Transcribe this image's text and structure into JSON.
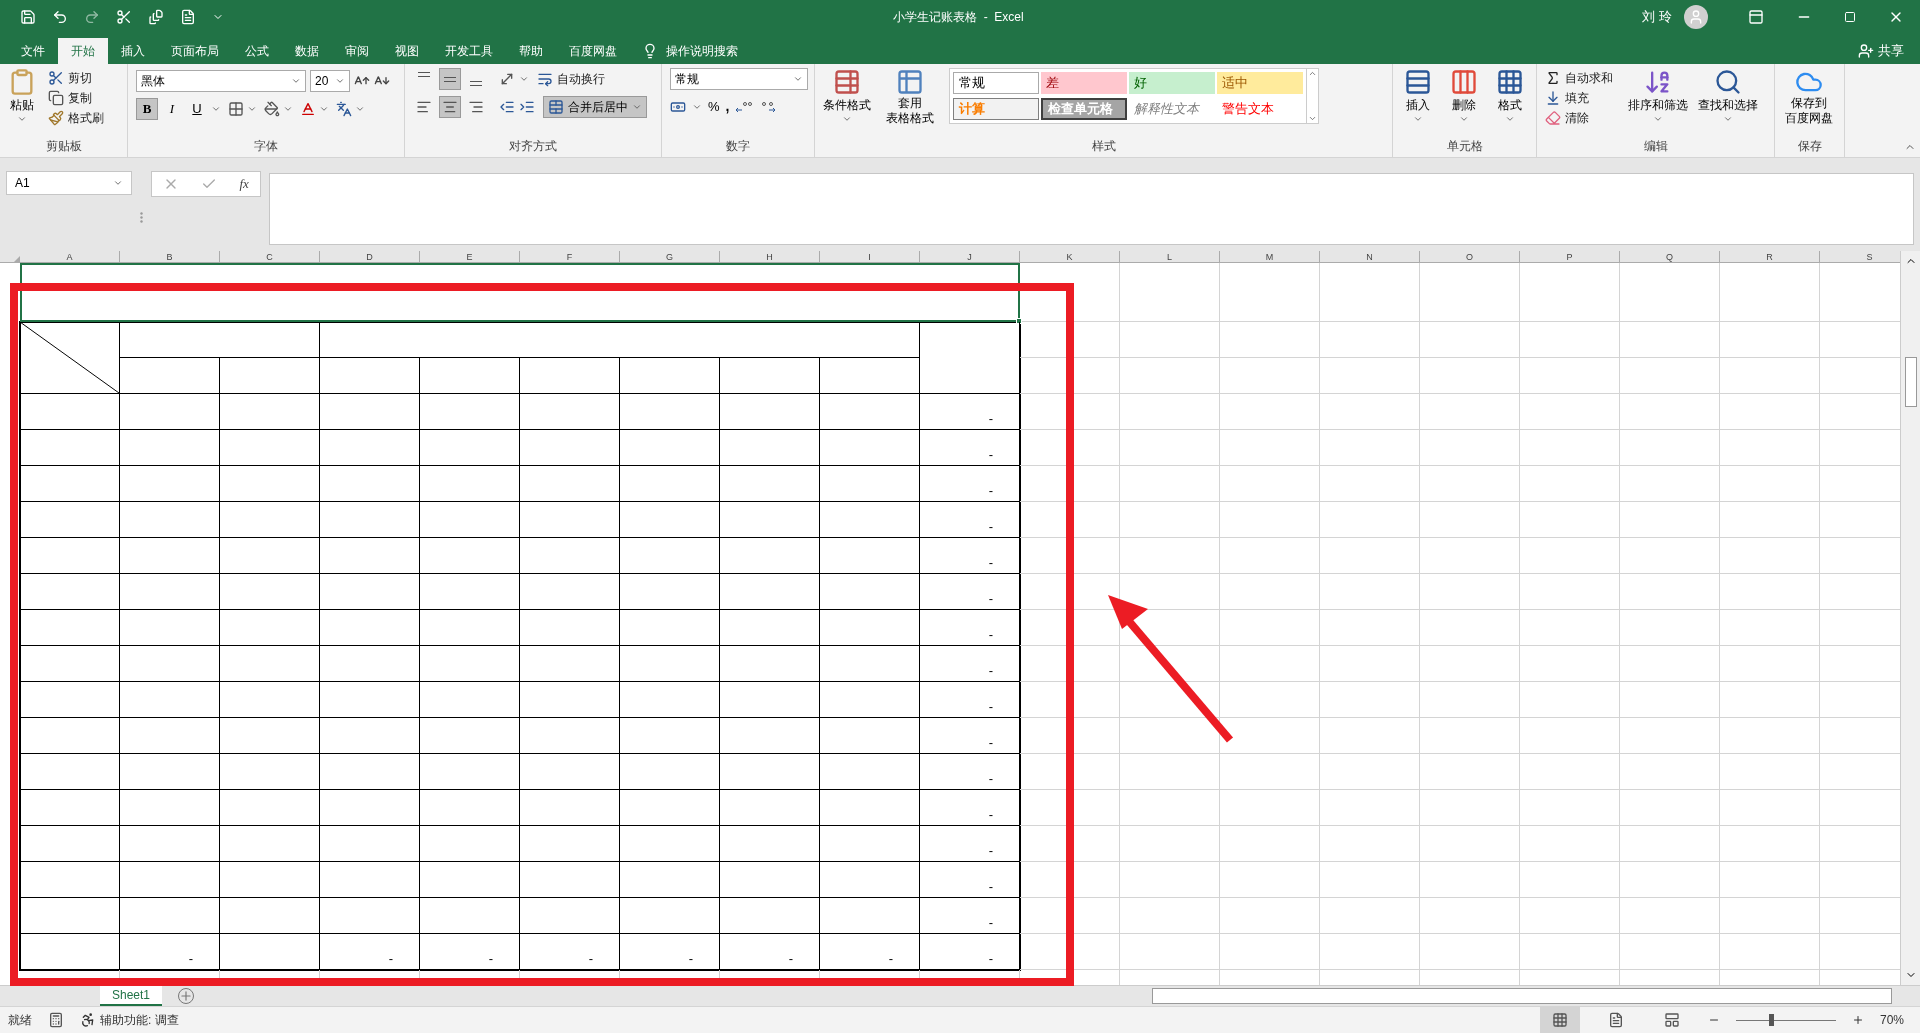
{
  "window": {
    "title": "小学生记账表格  -  Excel",
    "user": "刘 玲",
    "share": "共享"
  },
  "ribbon_tabs": [
    {
      "label": "文件",
      "selected": false
    },
    {
      "label": "开始",
      "selected": true
    },
    {
      "label": "插入",
      "selected": false
    },
    {
      "label": "页面布局",
      "selected": false
    },
    {
      "label": "公式",
      "selected": false
    },
    {
      "label": "数据",
      "selected": false
    },
    {
      "label": "审阅",
      "selected": false
    },
    {
      "label": "视图",
      "selected": false
    },
    {
      "label": "开发工具",
      "selected": false
    },
    {
      "label": "帮助",
      "selected": false
    },
    {
      "label": "百度网盘",
      "selected": false
    }
  ],
  "tell_me": "操作说明搜索",
  "clipboard": {
    "label": "剪贴板",
    "paste": "粘贴",
    "cut": "剪切",
    "copy": "复制",
    "format_painter": "格式刷"
  },
  "font": {
    "label": "字体",
    "name": "黑体",
    "size": "20",
    "bold": {
      "label": "B",
      "selected": true
    },
    "italic": {
      "label": "I",
      "selected": false
    },
    "underline": {
      "label": "U",
      "selected": false
    }
  },
  "alignment": {
    "label": "对齐方式",
    "vertical": [
      {
        "selected": false
      },
      {
        "selected": true
      },
      {
        "selected": false
      }
    ],
    "horizontal": [
      {
        "selected": false
      },
      {
        "selected": true
      },
      {
        "selected": false
      }
    ],
    "wrap": "自动换行",
    "merge": {
      "label": "合并后居中",
      "selected": true
    }
  },
  "number": {
    "label": "数字",
    "format": "常规",
    "percent": "%",
    "comma": ","
  },
  "styles": {
    "label": "样式",
    "conditional": "条件格式",
    "table": [
      "套用",
      "表格格式"
    ],
    "gallery": [
      {
        "label": "常规",
        "kind": "normal"
      },
      {
        "label": "差",
        "kind": "bad"
      },
      {
        "label": "好",
        "kind": "good"
      },
      {
        "label": "适中",
        "kind": "neutral"
      },
      {
        "label": "计算",
        "kind": "calculation"
      },
      {
        "label": "检查单元格",
        "kind": "check"
      },
      {
        "label": "解释性文本",
        "kind": "explanatory"
      },
      {
        "label": "警告文本",
        "kind": "warning"
      }
    ]
  },
  "cells_group": {
    "label": "单元格",
    "insert": "插入",
    "delete": "删除",
    "format": "格式"
  },
  "editing": {
    "label": "编辑",
    "autosum": "自动求和",
    "fill": "填充",
    "clear": "清除",
    "sort": "排序和筛选",
    "find": "查找和选择"
  },
  "save": {
    "label": "保存",
    "button": [
      "保存到",
      "百度网盘"
    ]
  },
  "formula_bar": {
    "name_box": "A1",
    "fx": "fx"
  },
  "columns": [
    "A",
    "B",
    "C",
    "D",
    "E",
    "F",
    "G",
    "H",
    "I",
    "J",
    "K",
    "L",
    "M",
    "N",
    "O",
    "P",
    "Q",
    "R",
    "S"
  ],
  "rows": [
    {
      "cells": [
        null,
        null,
        null,
        null,
        null,
        null,
        null,
        null,
        null,
        "-"
      ]
    },
    {
      "cells": [
        null,
        null,
        null,
        null,
        null,
        null,
        null,
        null,
        null,
        "-"
      ]
    },
    {
      "cells": [
        null,
        null,
        null,
        null,
        null,
        null,
        null,
        null,
        null,
        "-"
      ]
    },
    {
      "cells": [
        null,
        null,
        null,
        null,
        null,
        null,
        null,
        null,
        null,
        "-"
      ]
    },
    {
      "cells": [
        null,
        null,
        null,
        null,
        null,
        null,
        null,
        null,
        null,
        "-"
      ]
    },
    {
      "cells": [
        null,
        null,
        null,
        null,
        null,
        null,
        null,
        null,
        null,
        "-"
      ]
    },
    {
      "cells": [
        null,
        null,
        null,
        null,
        null,
        null,
        null,
        null,
        null,
        "-"
      ]
    },
    {
      "cells": [
        null,
        null,
        null,
        null,
        null,
        null,
        null,
        null,
        null,
        "-"
      ]
    },
    {
      "cells": [
        null,
        null,
        null,
        null,
        null,
        null,
        null,
        null,
        null,
        "-"
      ]
    },
    {
      "cells": [
        null,
        null,
        null,
        null,
        null,
        null,
        null,
        null,
        null,
        "-"
      ]
    },
    {
      "cells": [
        null,
        null,
        null,
        null,
        null,
        null,
        null,
        null,
        null,
        "-"
      ]
    },
    {
      "cells": [
        null,
        null,
        null,
        null,
        null,
        null,
        null,
        null,
        null,
        "-"
      ]
    },
    {
      "cells": [
        null,
        null,
        null,
        null,
        null,
        null,
        null,
        null,
        null,
        "-"
      ]
    },
    {
      "cells": [
        null,
        null,
        null,
        null,
        null,
        null,
        null,
        null,
        null,
        "-"
      ]
    },
    {
      "cells": [
        null,
        null,
        null,
        null,
        null,
        null,
        null,
        null,
        null,
        "-"
      ]
    },
    {
      "cells": [
        null,
        "-",
        null,
        "-",
        "-",
        "-",
        "-",
        "-",
        "-",
        "-"
      ]
    }
  ],
  "sheet_tabs": [
    {
      "label": "Sheet1",
      "selected": true
    }
  ],
  "status_bar": {
    "ready": "就绪",
    "accessibility": "辅助功能: 调查",
    "views": [
      {
        "selected": true
      },
      {
        "selected": false
      },
      {
        "selected": false
      }
    ],
    "zoom": {
      "level": 0.35,
      "reading": "70%"
    }
  }
}
